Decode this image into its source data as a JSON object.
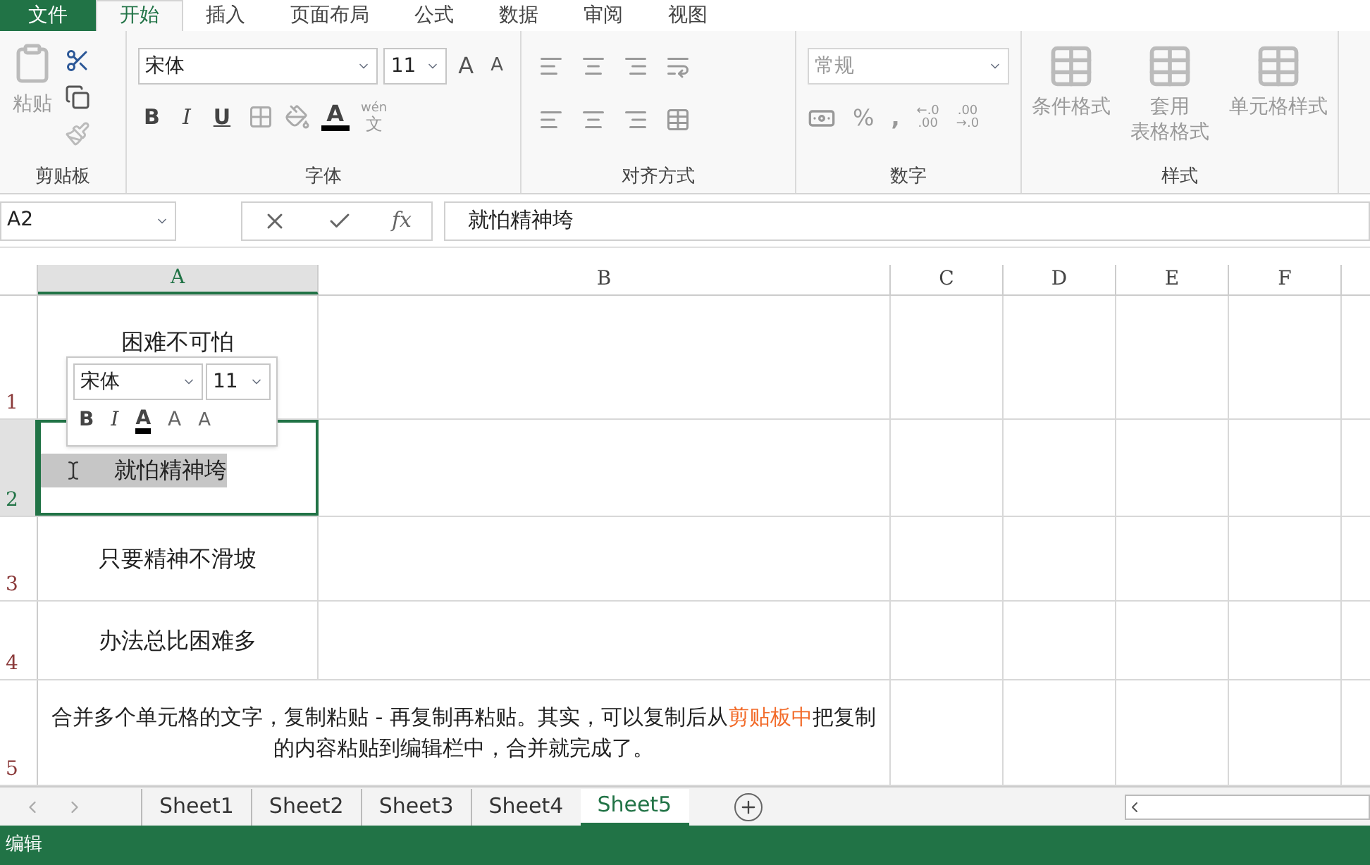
{
  "menu_tabs": [
    {
      "label": "文件",
      "kind": "file",
      "selected": false
    },
    {
      "label": "开始",
      "kind": "tab",
      "selected": true
    },
    {
      "label": "插入",
      "kind": "tab",
      "selected": false
    },
    {
      "label": "页面布局",
      "kind": "tab",
      "selected": false
    },
    {
      "label": "公式",
      "kind": "tab",
      "selected": false
    },
    {
      "label": "数据",
      "kind": "tab",
      "selected": false
    },
    {
      "label": "审阅",
      "kind": "tab",
      "selected": false
    },
    {
      "label": "视图",
      "kind": "tab",
      "selected": false
    }
  ],
  "ribbon": {
    "clipboard": {
      "paste": "粘贴",
      "group": "剪贴板"
    },
    "font": {
      "font_name": "宋体",
      "font_size": "11",
      "bold": "B",
      "italic": "I",
      "underline": "U",
      "font_color_letter": "A",
      "grow": "A",
      "shrink": "A",
      "phonetic_ruby": "wén",
      "phonetic_char": "文",
      "group": "字体"
    },
    "alignment": {
      "group": "对齐方式"
    },
    "number": {
      "format": "常规",
      "percent": "%",
      "comma": ",",
      "increase_decimal": [
        "←.0",
        ".00"
      ],
      "decrease_decimal": [
        ".00",
        "→.0"
      ],
      "group": "数字"
    },
    "styles": {
      "buttons": [
        {
          "lines": [
            "条件格式"
          ]
        },
        {
          "lines": [
            "套用",
            "表格格式"
          ]
        },
        {
          "lines": [
            "单元格样式"
          ]
        }
      ],
      "group": "样式"
    }
  },
  "formula_bar": {
    "name_box": "A2",
    "fx": "fx",
    "formula": "就怕精神垮"
  },
  "columns": [
    {
      "label": "A",
      "selected": true
    },
    {
      "label": "B",
      "selected": false
    },
    {
      "label": "C",
      "selected": false
    },
    {
      "label": "D",
      "selected": false
    },
    {
      "label": "E",
      "selected": false
    },
    {
      "label": "F",
      "selected": false
    }
  ],
  "rows": [
    {
      "header": "1",
      "selected": false,
      "text": "困难不可怕"
    },
    {
      "header": "2",
      "selected": true,
      "text": "就怕精神垮"
    },
    {
      "header": "3",
      "selected": false,
      "text": "只要精神不滑坡"
    },
    {
      "header": "4",
      "selected": false,
      "text": "办法总比困难多"
    },
    {
      "header": "5",
      "selected": false,
      "segments": [
        {
          "text": "合并多个单元格的文字，复制粘贴 - 再复制再粘贴。其实，可以复制后从",
          "highlighted": false
        },
        {
          "text": "剪贴板中",
          "highlighted": true
        },
        {
          "text": "把复制的内容粘贴到编辑栏中，合并就完成了。",
          "highlighted": false
        }
      ]
    }
  ],
  "mini_toolbar": {
    "font_name": "宋体",
    "font_size": "11",
    "bold": "B",
    "italic": "I",
    "font_color_letter": "A",
    "grow": "A",
    "shrink": "A"
  },
  "sheet_tabs": [
    {
      "label": "Sheet1",
      "selected": false
    },
    {
      "label": "Sheet2",
      "selected": false
    },
    {
      "label": "Sheet3",
      "selected": false
    },
    {
      "label": "Sheet4",
      "selected": false
    },
    {
      "label": "Sheet5",
      "selected": true
    }
  ],
  "status_bar": {
    "mode": "编辑"
  }
}
